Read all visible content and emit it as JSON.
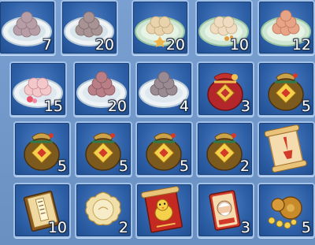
{
  "inventory": {
    "slots": [
      {
        "item": "plate-purple-dumplings",
        "icon": "dumpling-plate-icon",
        "count": "7",
        "ball_color": "#b79da6"
      },
      {
        "item": "plate-sesame-dumplings",
        "icon": "dumpling-plate-icon",
        "count": "20",
        "ball_color": "#a89394"
      },
      {
        "item": "plate-peanut-dumplings",
        "icon": "dumpling-plate-icon",
        "count": "20",
        "ball_color": "#e8d3ad"
      },
      {
        "item": "plate-osmanthus-dumplings",
        "icon": "dumpling-plate-icon",
        "count": "10",
        "ball_color": "#efdcc0"
      },
      {
        "item": "plate-red-bean-dumplings",
        "icon": "dumpling-plate-icon",
        "count": "12",
        "ball_color": "#e7a386"
      },
      {
        "item": "plate-rose-dumplings",
        "icon": "dumpling-plate-icon",
        "count": "15",
        "ball_color": "#f2c8cb"
      },
      {
        "item": "plate-taro-dumplings",
        "icon": "dumpling-plate-icon",
        "count": "20",
        "ball_color": "#b97f86"
      },
      {
        "item": "plate-black-sesame-dumplings",
        "icon": "dumpling-plate-icon",
        "count": "4",
        "ball_color": "#9a8a92"
      },
      {
        "item": "red-lucky-bag",
        "icon": "red-lucky-bag-icon",
        "count": "3"
      },
      {
        "item": "golden-lucky-bag",
        "icon": "golden-lucky-bag-icon",
        "count": "5"
      },
      {
        "item": "golden-lucky-bag",
        "icon": "golden-lucky-bag-icon",
        "count": "5"
      },
      {
        "item": "golden-lucky-bag",
        "icon": "golden-lucky-bag-icon",
        "count": "5"
      },
      {
        "item": "golden-lucky-bag",
        "icon": "golden-lucky-bag-icon",
        "count": "5"
      },
      {
        "item": "golden-lucky-bag",
        "icon": "golden-lucky-bag-icon",
        "count": "2"
      },
      {
        "item": "brush-scroll",
        "icon": "brush-scroll-icon",
        "count": ""
      },
      {
        "item": "manual-book",
        "icon": "book-icon",
        "count": "10"
      },
      {
        "item": "moon-cake",
        "icon": "mooncake-icon",
        "count": "2"
      },
      {
        "item": "chick-scroll",
        "icon": "chick-scroll-icon",
        "count": ""
      },
      {
        "item": "elder-card",
        "icon": "elder-card-icon",
        "count": "3"
      },
      {
        "item": "gold-gourd-coins",
        "icon": "gourd-coins-icon",
        "count": "5"
      }
    ]
  }
}
